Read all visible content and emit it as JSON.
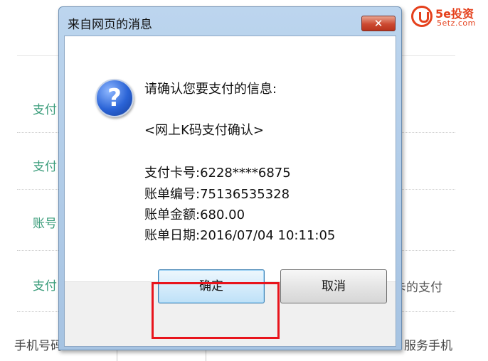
{
  "background": {
    "labels": [
      "支付",
      "支付",
      "账号",
      "支付"
    ],
    "right_text": "卡的支付",
    "bottom_left_text": "手机号码",
    "bottom_right_text": "服务手机"
  },
  "logo": {
    "title": "5e投资",
    "url": "5etz.com",
    "color": "#e5401c"
  },
  "dialog": {
    "title": "来自网页的消息",
    "close_label": "✕",
    "icon": "question-icon",
    "lines": {
      "prompt": "请确认您要支付的信息:",
      "subject": "<网上K码支付确认>",
      "card_number": "支付卡号:6228****6875",
      "bill_number": "账单编号:75136535328",
      "bill_amount": "账单金额:680.00",
      "bill_date": "账单日期:2016/07/04 10:11:05"
    },
    "buttons": {
      "ok": "确定",
      "cancel": "取消"
    }
  },
  "colors": {
    "accent_green": "#3a9c7a",
    "highlight_red": "#e8141c"
  }
}
